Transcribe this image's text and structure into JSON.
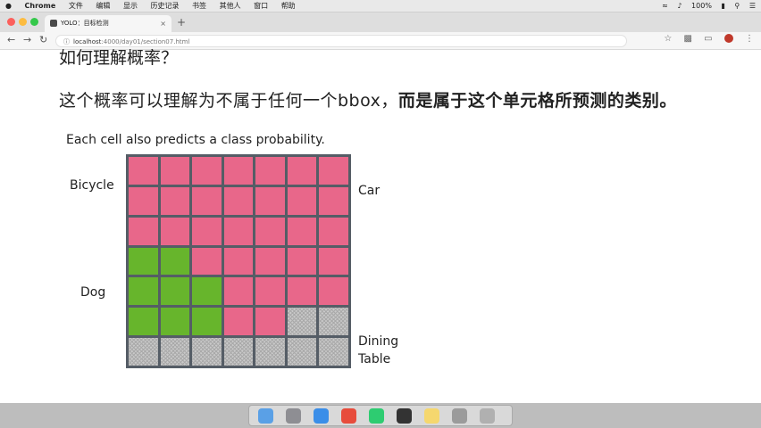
{
  "menubar": {
    "apple": "",
    "app": "Chrome",
    "items": [
      "文件",
      "编辑",
      "显示",
      "历史记录",
      "书签",
      "其他人",
      "窗口",
      "帮助"
    ],
    "battery": "100%"
  },
  "browser": {
    "tab_title": "YOLO：目标检测",
    "tab_close": "×",
    "new_tab": "+",
    "url_host": "localhost",
    "url_path": ":4000/day01/section07.html"
  },
  "slide": {
    "question": "如何理解概率？",
    "answer_part1": "这个概率可以理解为不属于任何一个bbox，",
    "answer_part2": "而是属于这个单元格所预测的类别。",
    "caption": "Each cell also predicts a class probability.",
    "labels": {
      "bicycle": "Bicycle",
      "car": "Car",
      "dog": "Dog",
      "dining": "Dining",
      "table": "Table"
    },
    "grid": {
      "cols": 7,
      "rows": 7,
      "colors": {
        "car": "#e8678a",
        "dog": "#67b52c",
        "dining": "#c9c9c9",
        "border": "#555d66"
      },
      "cells": [
        [
          "car",
          "car",
          "car",
          "car",
          "car",
          "car",
          "car"
        ],
        [
          "car",
          "car",
          "car",
          "car",
          "car",
          "car",
          "car"
        ],
        [
          "car",
          "car",
          "car",
          "car",
          "car",
          "car",
          "car"
        ],
        [
          "dog",
          "dog",
          "car",
          "car",
          "car",
          "car",
          "car"
        ],
        [
          "dog",
          "dog",
          "dog",
          "car",
          "car",
          "car",
          "car"
        ],
        [
          "dog",
          "dog",
          "dog",
          "car",
          "car",
          "dining",
          "dining"
        ],
        [
          "dining",
          "dining",
          "dining",
          "dining",
          "dining",
          "dining",
          "dining"
        ]
      ]
    }
  },
  "dock": {
    "icons": [
      "finder",
      "launchpad",
      "safari",
      "chrome",
      "pycharm",
      "terminal",
      "notes",
      "preferences",
      "trash"
    ]
  }
}
